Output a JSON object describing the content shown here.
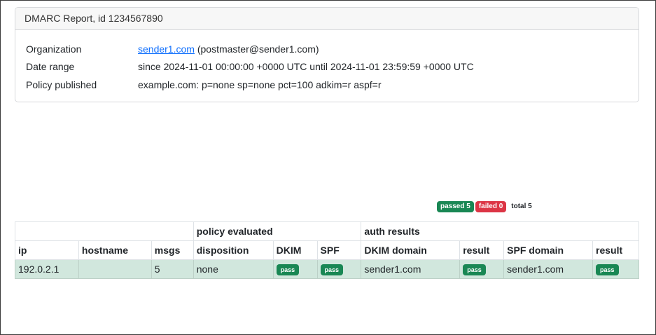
{
  "report": {
    "title": "DMARC Report, id 1234567890",
    "organization_label": "Organization",
    "organization_link": "sender1.com",
    "organization_email": "(postmaster@sender1.com)",
    "date_range_label": "Date range",
    "date_range_value": "since 2024-11-01 00:00:00 +0000 UTC until 2024-11-01 23:59:59 +0000 UTC",
    "policy_label": "Policy published",
    "policy_value": "example.com: p=none sp=none pct=100 adkim=r aspf=r"
  },
  "summary": {
    "passed": "passed 5",
    "failed": "failed 0",
    "total": "total 5"
  },
  "table": {
    "group_headers": [
      "",
      "policy evaluated",
      "auth results"
    ],
    "columns": [
      "ip",
      "hostname",
      "msgs",
      "disposition",
      "DKIM",
      "SPF",
      "DKIM domain",
      "result",
      "SPF domain",
      "result"
    ],
    "rows": [
      {
        "ip": "192.0.2.1",
        "hostname": "",
        "msgs": "5",
        "disposition": "none",
        "dkim": "pass",
        "spf": "pass",
        "dkim_domain": "sender1.com",
        "dkim_result": "pass",
        "spf_domain": "sender1.com",
        "spf_result": "pass"
      }
    ]
  },
  "colors": {
    "pass_green": "#198754",
    "fail_red": "#dc3545",
    "row_success_bg": "#d1e7dd",
    "link_blue": "#0d6efd"
  }
}
